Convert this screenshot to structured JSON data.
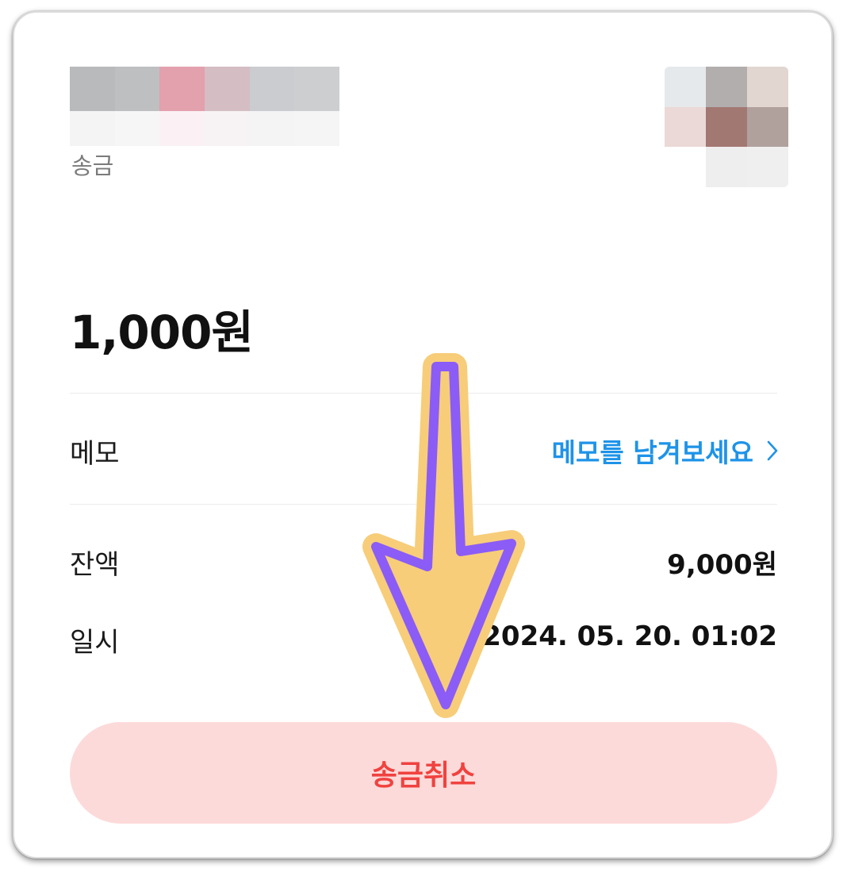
{
  "transfer": {
    "type_label": "송금",
    "amount": "1,000원"
  },
  "details": {
    "memo_label": "메모",
    "memo_action": "메모를 남겨보세요",
    "balance_label": "잔액",
    "balance_value": "9,000원",
    "datetime_label": "일시",
    "datetime_value": "2024. 05. 20. 01:02"
  },
  "actions": {
    "cancel_label": "송금취소"
  },
  "colors": {
    "memo_link": "#1e93e8",
    "cancel_bg": "#fddada",
    "cancel_text": "#f0423f",
    "arrow_fill": "#f7cd7a",
    "arrow_stroke": "#8b5cf6"
  },
  "icons": {
    "memo_chevron": "chevron-right-icon",
    "annotation": "down-arrow-icon"
  }
}
